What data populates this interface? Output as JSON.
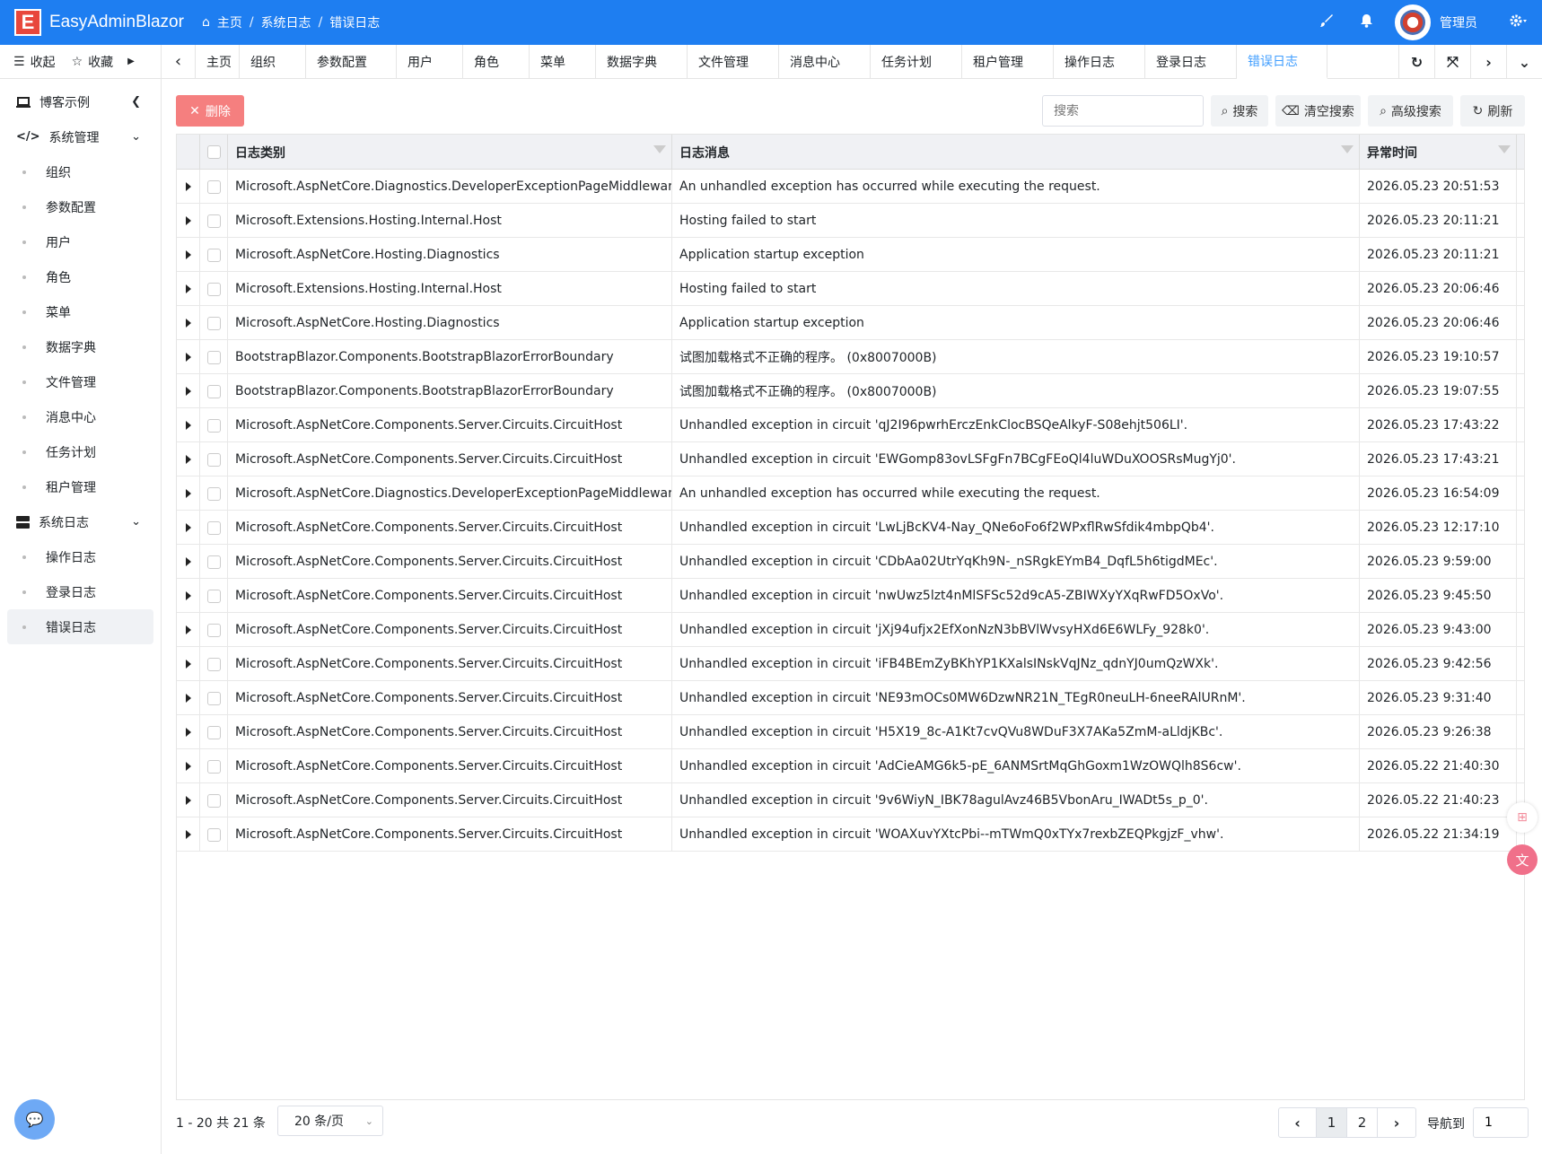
{
  "header": {
    "logo_letter": "E",
    "brand": "EasyAdminBlazor",
    "breadcrumb": [
      "主页",
      "系统日志",
      "错误日志"
    ],
    "user_name": "管理员"
  },
  "side_toolbar": {
    "collapse": "收起",
    "favorite": "收藏"
  },
  "sidebar": {
    "groups": [
      {
        "label": "博客示例",
        "icon": "laptop-icon",
        "items": []
      },
      {
        "label": "系统管理",
        "icon": "code-icon",
        "items": [
          "组织",
          "参数配置",
          "用户",
          "角色",
          "菜单",
          "数据字典",
          "文件管理",
          "消息中心",
          "任务计划",
          "租户管理"
        ]
      },
      {
        "label": "系统日志",
        "icon": "server-icon",
        "items": [
          "操作日志",
          "登录日志",
          "错误日志"
        ]
      }
    ],
    "active_item": "错误日志"
  },
  "tabs": [
    "主页",
    "组织",
    "参数配置",
    "用户",
    "角色",
    "菜单",
    "数据字典",
    "文件管理",
    "消息中心",
    "任务计划",
    "租户管理",
    "操作日志",
    "登录日志",
    "错误日志"
  ],
  "active_tab": "错误日志",
  "toolbar": {
    "delete": "删除",
    "search_placeholder": "搜索",
    "search": "搜索",
    "clear_search": "清空搜索",
    "advanced_search": "高级搜索",
    "refresh": "刷新"
  },
  "table": {
    "columns": [
      "日志类别",
      "日志消息",
      "异常时间"
    ],
    "rows": [
      [
        "Microsoft.AspNetCore.Diagnostics.DeveloperExceptionPageMiddleware",
        "An unhandled exception has occurred while executing the request.",
        "2026.05.23 20:51:53"
      ],
      [
        "Microsoft.Extensions.Hosting.Internal.Host",
        "Hosting failed to start",
        "2026.05.23 20:11:21"
      ],
      [
        "Microsoft.AspNetCore.Hosting.Diagnostics",
        "Application startup exception",
        "2026.05.23 20:11:21"
      ],
      [
        "Microsoft.Extensions.Hosting.Internal.Host",
        "Hosting failed to start",
        "2026.05.23 20:06:46"
      ],
      [
        "Microsoft.AspNetCore.Hosting.Diagnostics",
        "Application startup exception",
        "2026.05.23 20:06:46"
      ],
      [
        "BootstrapBlazor.Components.BootstrapBlazorErrorBoundary",
        "试图加载格式不正确的程序。 (0x8007000B)",
        "2026.05.23 19:10:57"
      ],
      [
        "BootstrapBlazor.Components.BootstrapBlazorErrorBoundary",
        "试图加载格式不正确的程序。 (0x8007000B)",
        "2026.05.23 19:07:55"
      ],
      [
        "Microsoft.AspNetCore.Components.Server.Circuits.CircuitHost",
        "Unhandled exception in circuit 'qJ2I96pwrhErczEnkClocBSQeAlkyF-S08ehjt506LI'.",
        "2026.05.23 17:43:22"
      ],
      [
        "Microsoft.AspNetCore.Components.Server.Circuits.CircuitHost",
        "Unhandled exception in circuit 'EWGomp83ovLSFgFn7BCgFEoQl4luWDuXOOSRsMugYj0'.",
        "2026.05.23 17:43:21"
      ],
      [
        "Microsoft.AspNetCore.Diagnostics.DeveloperExceptionPageMiddleware",
        "An unhandled exception has occurred while executing the request.",
        "2026.05.23 16:54:09"
      ],
      [
        "Microsoft.AspNetCore.Components.Server.Circuits.CircuitHost",
        "Unhandled exception in circuit 'LwLjBcKV4-Nay_QNe6oFo6f2WPxflRwSfdik4mbpQb4'.",
        "2026.05.23 12:17:10"
      ],
      [
        "Microsoft.AspNetCore.Components.Server.Circuits.CircuitHost",
        "Unhandled exception in circuit 'CDbAa02UtrYqKh9N-_nSRgkEYmB4_DqfL5h6tigdMEc'.",
        "2026.05.23 9:59:00"
      ],
      [
        "Microsoft.AspNetCore.Components.Server.Circuits.CircuitHost",
        "Unhandled exception in circuit 'nwUwz5lzt4nMlSFSc52d9cA5-ZBIWXyYXqRwFD5OxVo'.",
        "2026.05.23 9:45:50"
      ],
      [
        "Microsoft.AspNetCore.Components.Server.Circuits.CircuitHost",
        "Unhandled exception in circuit 'jXj94ufjx2EfXonNzN3bBVlWvsyHXd6E6WLFy_928k0'.",
        "2026.05.23 9:43:00"
      ],
      [
        "Microsoft.AspNetCore.Components.Server.Circuits.CircuitHost",
        "Unhandled exception in circuit 'iFB4BEmZyBKhYP1KXalsINskVqJNz_qdnYJ0umQzWXk'.",
        "2026.05.23 9:42:56"
      ],
      [
        "Microsoft.AspNetCore.Components.Server.Circuits.CircuitHost",
        "Unhandled exception in circuit 'NE93mOCs0MW6DzwNR21N_TEgR0neuLH-6neeRAlURnM'.",
        "2026.05.23 9:31:40"
      ],
      [
        "Microsoft.AspNetCore.Components.Server.Circuits.CircuitHost",
        "Unhandled exception in circuit 'H5X19_8c-A1Kt7cvQVu8WDuF3X7AKa5ZmM-aLldjKBc'.",
        "2026.05.23 9:26:38"
      ],
      [
        "Microsoft.AspNetCore.Components.Server.Circuits.CircuitHost",
        "Unhandled exception in circuit 'AdCieAMG6k5-pE_6ANMSrtMqGhGoxm1WzOWQlh8S6cw'.",
        "2026.05.22 21:40:30"
      ],
      [
        "Microsoft.AspNetCore.Components.Server.Circuits.CircuitHost",
        "Unhandled exception in circuit '9v6WiyN_IBK78agulAvz46B5VbonAru_IWADt5s_p_0'.",
        "2026.05.22 21:40:23"
      ],
      [
        "Microsoft.AspNetCore.Components.Server.Circuits.CircuitHost",
        "Unhandled exception in circuit 'WOAXuvYXtcPbi--mTWmQ0xTYx7rexbZEQPkgjzF_vhw'.",
        "2026.05.22 21:34:19"
      ]
    ]
  },
  "footer": {
    "info": "1 - 20 共 21 条",
    "page_size": "20 条/页",
    "pages": [
      "1",
      "2"
    ],
    "current_page": "1",
    "goto_label": "导航到",
    "goto_value": "1"
  }
}
